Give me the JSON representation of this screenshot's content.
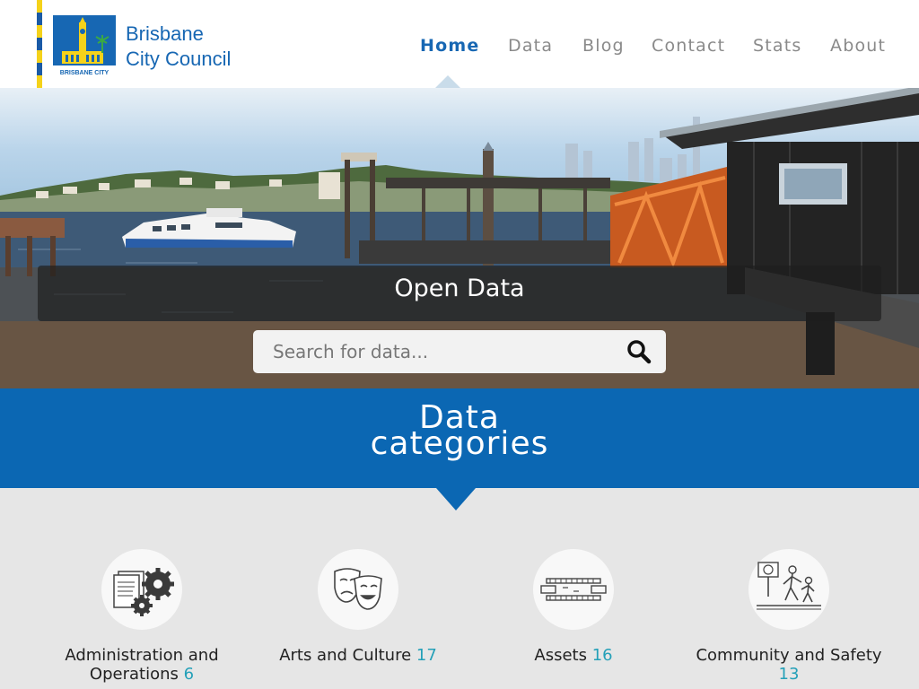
{
  "brand": {
    "line1": "Brisbane",
    "line2": "City Council",
    "badge_text": "BRISBANE CITY",
    "primary_color": "#1767b3",
    "accent_color": "#f5d21a"
  },
  "nav": {
    "items": [
      {
        "label": "Home",
        "active": true
      },
      {
        "label": "Data",
        "active": false
      },
      {
        "label": "Blog",
        "active": false
      },
      {
        "label": "Contact",
        "active": false
      },
      {
        "label": "Stats",
        "active": false
      },
      {
        "label": "About",
        "active": false
      }
    ]
  },
  "hero": {
    "title": "Open Data",
    "search_placeholder": "Search for data...",
    "search_icon": "search-icon"
  },
  "categories": {
    "title_line1": "Data",
    "title_line2": "categories",
    "count_color": "#24a0b8",
    "items": [
      {
        "label_line1": "Administration and",
        "label_line2": "Operations",
        "count": "6",
        "icon": "documents-gears-icon"
      },
      {
        "label_line1": "Arts and Culture",
        "label_line2": "",
        "count": "17",
        "icon": "theatre-masks-icon"
      },
      {
        "label_line1": "Assets",
        "label_line2": "",
        "count": "16",
        "icon": "bridge-icon"
      },
      {
        "label_line1": "Community and Safety",
        "label_line2": "",
        "count": "13",
        "icon": "pedestrians-sign-icon"
      }
    ]
  }
}
